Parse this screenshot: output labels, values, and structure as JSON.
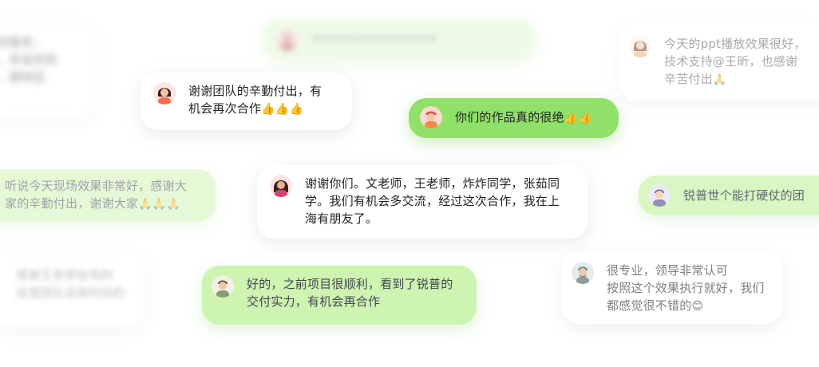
{
  "messages": {
    "m1": {
      "text": "谢谢团队的辛勤付出，有\n机会再次合作",
      "emoji": "👍👍👍"
    },
    "m2": {
      "text": "你们的作品真的很绝",
      "emoji": "👍👍"
    },
    "m3": {
      "text": "今天的ppt播放效果很好，\n技术支持@王昕，也感谢\n辛苦付出",
      "emoji": "🙏"
    },
    "m4": {
      "text": "听说今天现场效果非常好，感谢大\n家的辛勤付出，谢谢大家",
      "emoji": "🙏🙏🙏"
    },
    "m5": {
      "text": "谢谢你们。文老师，王老师，炸炸同学，张茹同\n学。我们有机会多交流，经过这次合作，我在上\n海有朋友了。",
      "emoji": ""
    },
    "m6": {
      "text": "锐普世个能打硬仗的团",
      "emoji": ""
    },
    "m7": {
      "text": "感谢王老师驻场的\n运营团队这段时间的",
      "emoji": ""
    },
    "m8": {
      "text": "好的，之前项目很顺利，看到了锐普的\n交付实力，有机会再合作",
      "emoji": ""
    },
    "m9": {
      "text": "很专业，领导非常认可\n按照这个效果执行就好，我们\n都感觉很不错的",
      "emoji": "😊"
    },
    "m10": {
      "text": "的服务，\n，非会机构\n，期待后",
      "emoji": ""
    },
    "m11": {
      "text": "▬▬▬▬▬▬▬▬▬▬▬",
      "emoji": ""
    }
  }
}
